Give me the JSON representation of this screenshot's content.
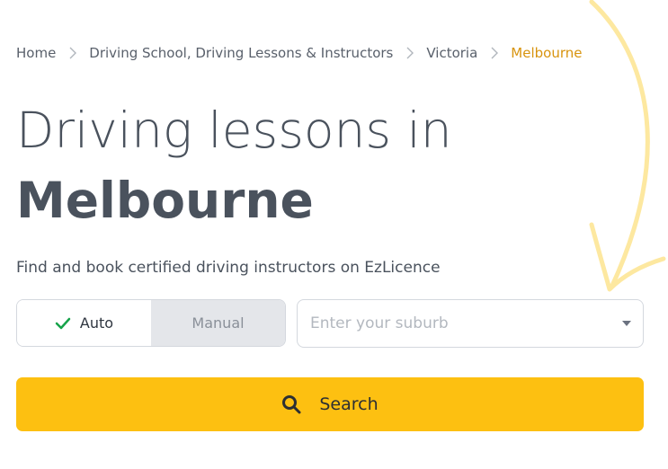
{
  "breadcrumb": {
    "items": [
      "Home",
      "Driving School, Driving Lessons & Instructors",
      "Victoria"
    ],
    "current": "Melbourne"
  },
  "hero": {
    "title_line1": "Driving lessons in",
    "title_line2": "Melbourne",
    "subtitle": "Find and book certified driving instructors on EzLicence"
  },
  "transmission": {
    "options": [
      {
        "label": "Auto",
        "selected": true
      },
      {
        "label": "Manual",
        "selected": false
      }
    ]
  },
  "suburb": {
    "placeholder": "Enter your suburb",
    "value": ""
  },
  "search": {
    "label": "Search"
  },
  "icons": {
    "separator": "chevron-right-icon",
    "check": "check-icon",
    "dropdown": "caret-down-icon",
    "search": "search-icon"
  },
  "colors": {
    "accent": "#fdc011",
    "breadcrumb_current": "#d8940f",
    "check": "#16a34a",
    "decor_arrow": "#fde8a0"
  }
}
